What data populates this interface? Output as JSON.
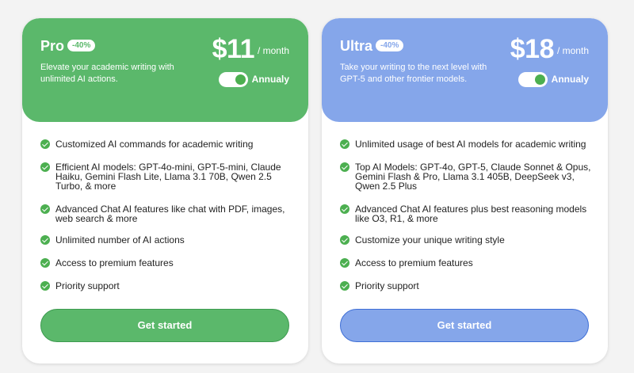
{
  "plans": [
    {
      "name": "Pro",
      "discount": "-40%",
      "description": "Elevate your academic writing with unlimited AI actions.",
      "price": "$11",
      "period": "/ month",
      "billing_label": "Annualy",
      "billing_annual_on": true,
      "color": "#5bb86b",
      "features": [
        "Customized AI commands for academic writing",
        "Efficient AI models: GPT-4o-mini, GPT-5-mini, Claude Haiku, Gemini Flash Lite, Llama 3.1 70B, Qwen 2.5 Turbo, & more",
        "Advanced Chat AI features like chat with PDF, images, web search & more",
        "Unlimited number of AI actions",
        "Access to premium features",
        "Priority support"
      ],
      "cta_label": "Get started"
    },
    {
      "name": "Ultra",
      "discount": "-40%",
      "description": "Take your writing to the next level with GPT-5 and other frontier models.",
      "price": "$18",
      "period": "/ month",
      "billing_label": "Annualy",
      "billing_annual_on": true,
      "color": "#85a6ea",
      "features": [
        "Unlimited usage of best AI models for academic writing",
        "Top AI Models: GPT-4o, GPT-5, Claude Sonnet & Opus, Gemini Flash & Pro, Llama 3.1 405B, DeepSeek v3, Qwen 2.5 Plus",
        "Advanced Chat AI features plus best reasoning models like O3, R1, & more",
        "Customize your unique writing style",
        "Access to premium features",
        "Priority support"
      ],
      "cta_label": "Get started"
    }
  ],
  "icons": {
    "feature_bullet": "check-circle-icon"
  }
}
